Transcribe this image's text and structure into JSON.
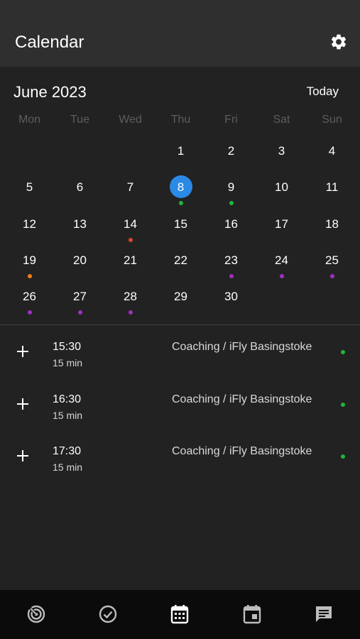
{
  "app_bar": {
    "title": "Calendar",
    "settings_icon": "gear-icon"
  },
  "calendar": {
    "month_label": "June 2023",
    "today_label": "Today",
    "weekdays": [
      "Mon",
      "Tue",
      "Wed",
      "Thu",
      "Fri",
      "Sat",
      "Sun"
    ],
    "selected_day": "8",
    "colors": {
      "selected": "#2b8ae6",
      "green": "#1fb53b",
      "red": "#e0452a",
      "orange": "#f07d1a",
      "purple": "#a12fbf"
    },
    "weeks": [
      [
        {
          "d": ""
        },
        {
          "d": ""
        },
        {
          "d": ""
        },
        {
          "d": "1"
        },
        {
          "d": "2"
        },
        {
          "d": "3"
        },
        {
          "d": "4"
        }
      ],
      [
        {
          "d": "5"
        },
        {
          "d": "6"
        },
        {
          "d": "7"
        },
        {
          "d": "8",
          "dot": "green",
          "selected": true
        },
        {
          "d": "9",
          "dot": "green"
        },
        {
          "d": "10"
        },
        {
          "d": "11"
        }
      ],
      [
        {
          "d": "12"
        },
        {
          "d": "13"
        },
        {
          "d": "14",
          "dot": "red"
        },
        {
          "d": "15"
        },
        {
          "d": "16"
        },
        {
          "d": "17"
        },
        {
          "d": "18"
        }
      ],
      [
        {
          "d": "19",
          "dot": "orange"
        },
        {
          "d": "20"
        },
        {
          "d": "21"
        },
        {
          "d": "22"
        },
        {
          "d": "23",
          "dot": "purple"
        },
        {
          "d": "24",
          "dot": "purple"
        },
        {
          "d": "25",
          "dot": "purple"
        }
      ],
      [
        {
          "d": "26",
          "dot": "purple"
        },
        {
          "d": "27",
          "dot": "purple"
        },
        {
          "d": "28",
          "dot": "purple"
        },
        {
          "d": "29"
        },
        {
          "d": "30"
        },
        {
          "d": ""
        },
        {
          "d": ""
        }
      ]
    ]
  },
  "slots": [
    {
      "time": "15:30",
      "duration": "15 min",
      "title": "Coaching / iFly Basingstoke",
      "status_color": "#1fb53b"
    },
    {
      "time": "16:30",
      "duration": "15 min",
      "title": "Coaching / iFly Basingstoke",
      "status_color": "#1fb53b"
    },
    {
      "time": "17:30",
      "duration": "15 min",
      "title": "Coaching / iFly Basingstoke",
      "status_color": "#1fb53b"
    }
  ],
  "tabs": [
    {
      "icon": "radar-icon"
    },
    {
      "icon": "check-circle-icon"
    },
    {
      "icon": "calendar-grid-icon",
      "active": true
    },
    {
      "icon": "calendar-event-icon"
    },
    {
      "icon": "chat-icon"
    }
  ]
}
